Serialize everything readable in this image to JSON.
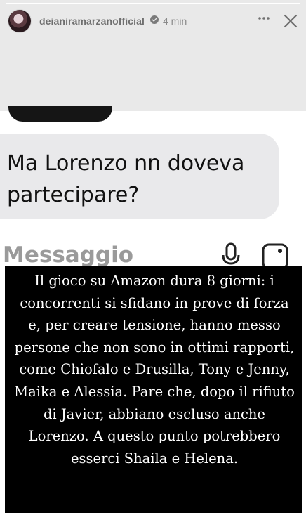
{
  "story": {
    "username": "deianiramarzanofficial",
    "verified": true,
    "time": "4 min",
    "progress_fraction": 1.0
  },
  "icons": {
    "verified": "verified-badge-icon",
    "more": "more-options-icon",
    "close": "close-icon",
    "mic": "microphone-icon",
    "gallery": "gallery-icon"
  },
  "colors": {
    "background": "#ffffff",
    "header_background": "#e9e9e9",
    "bubble": "#e9e9eb",
    "caption_background": "#000000",
    "caption_text": "#ffffff"
  },
  "screenshot": {
    "message": "Ma Lorenzo nn doveva partecipare?",
    "composer_placeholder": "Messaggio"
  },
  "caption": {
    "text": "Il gioco su Amazon dura 8 giorni: i concorrenti si sfidano in prove di forza e, per creare tensione, hanno messo persone che non sono in ottimi rapporti, come Chiofalo e Drusilla, Tony e Jenny, Maika e Alessia. Pare che, dopo il rifiuto di Javier, abbiano escluso anche Lorenzo. A questo punto potrebbero esserci Shaila e Helena."
  }
}
